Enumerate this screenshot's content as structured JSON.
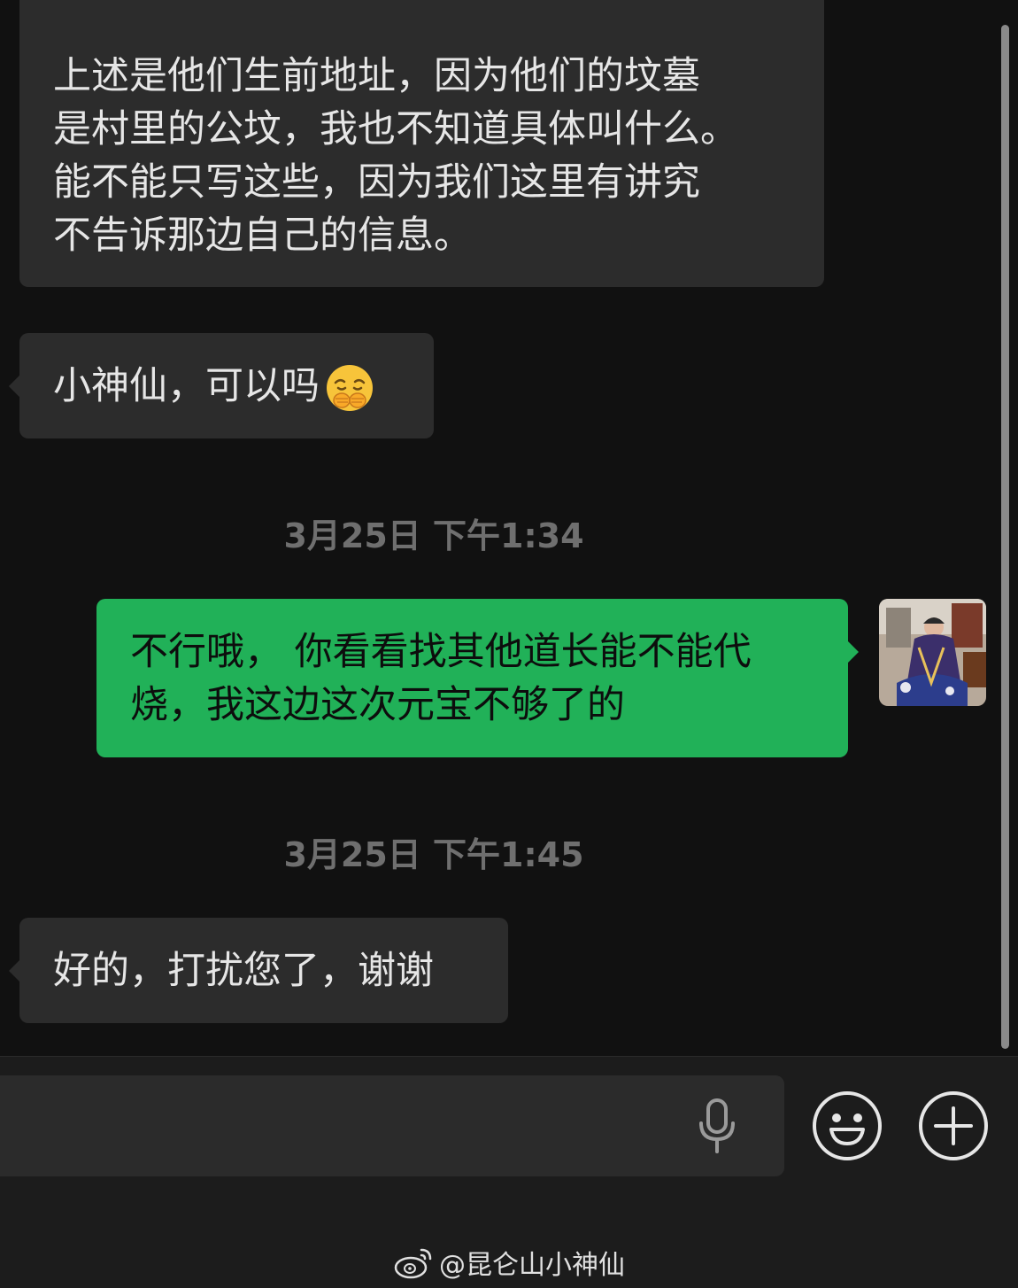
{
  "messages": [
    {
      "lines": [
        "上述是他们生前地址，因为他们的坟墓",
        "是村里的公坟，我也不知道具体叫什么。",
        "能不能只写这些，因为我们这里有讲究",
        "不告诉那边自己的信息。"
      ]
    },
    {
      "text": "小神仙，可以吗",
      "emoji": "pleading-hand-over-mouth-face"
    },
    {
      "timestamp": "3月25日 下午1:34"
    },
    {
      "lines": [
        "不行哦， 你看看找其他道长能不能代",
        "烧，我这边这次元宝不够了的"
      ]
    },
    {
      "timestamp": "3月25日 下午1:45"
    },
    {
      "text": "好的，打扰您了，谢谢"
    }
  ],
  "colors": {
    "background": "#111111",
    "received_bubble": "#2c2c2c",
    "sent_bubble": "#21b158",
    "timestamp": "#6f6f6f"
  },
  "watermark": {
    "text": "@昆仑山小神仙",
    "icon": "weibo-icon"
  },
  "input_bar": {
    "icons": [
      "microphone-icon",
      "emoji-icon",
      "plus-icon"
    ]
  }
}
